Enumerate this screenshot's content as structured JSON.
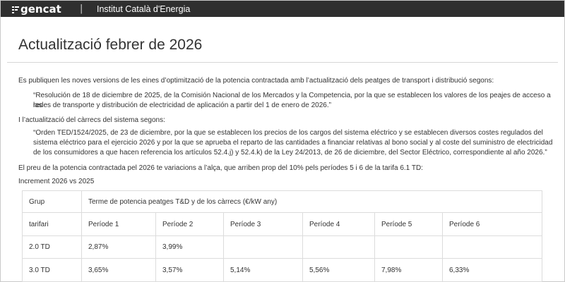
{
  "header": {
    "logo_text": "gencat",
    "separator": "|",
    "institution": "Institut Català d'Energia"
  },
  "page": {
    "title": "Actualització febrer de 2026"
  },
  "content": {
    "intro": "Es publiquen les noves versions de les eines d’optimització de la potencia contractada amb  l’actualització dels peatges de transport i distribució segons:",
    "quote1_line1": "“Resolución de 18 de diciembre de 2025, de la Comisión Nacional de los Mercados y la Competencia, por la que se establecen los valores de los peajes de acceso a las",
    "quote1_line2": "redes de transporte y distribución de electricidad de aplicación a partir del 1 de enero de 2026.”",
    "para2": "I l’actualització del càrrecs del sistema segons:",
    "quote2_line1": "“Orden TED/1524/2025, de 23 de diciembre, por la que se establecen los precios de los cargos del sistema eléctrico y se establecen diversos costes regulados del",
    "quote2_line2": "sistema eléctrico para el ejercicio 2026 y por la que se aprueba el reparto de las cantidades a financiar relativas al bono social y al coste del suministro de electricidad",
    "quote2_line3": "de los consumidores a que hacen referencia los artículos 52.4.j) y 52.4.k) de la Ley 24/2013, de 26 de diciembre, del Sector Eléctrico, correspondiente al año 2026.”",
    "para3": "El preu de la potencia contractada pel 2026 te variacions a l’alça, que arriben prop del 10% pels períodes 5 i 6 de la tarifa 6.1 TD:",
    "para4": "Increment 2026 vs 2025"
  },
  "table": {
    "header_group": "Grup",
    "header_term": "Terme de potencia peatges T&D y de los càrrecs (€/kW any)",
    "subheader": [
      "tarifari",
      "Període 1",
      "Període 2",
      "Període 3",
      "Període 4",
      "Període 5",
      "Període 6"
    ],
    "rows": [
      [
        "2.0 TD",
        "2,87%",
        "3,99%",
        "",
        "",
        "",
        ""
      ],
      [
        "3.0 TD",
        "3,65%",
        "3,57%",
        "5,14%",
        "5,56%",
        "7,98%",
        "6,33%"
      ]
    ]
  }
}
